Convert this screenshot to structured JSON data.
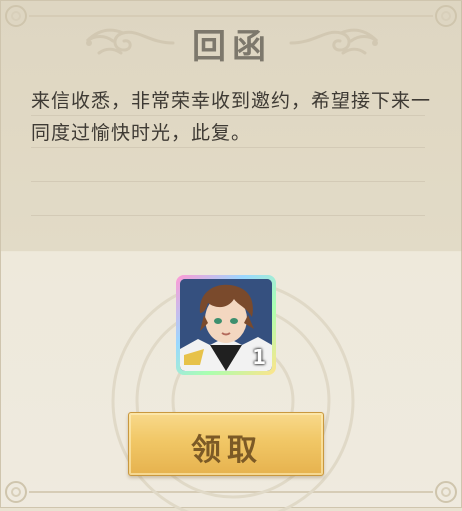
{
  "letter": {
    "title": "回函",
    "body": "来信收悉，非常荣幸收到邀约，希望接下来一同度过愉快时光，此复。"
  },
  "reward": {
    "icon": "character-portrait-icon",
    "count": "1"
  },
  "claim_button": {
    "label": "领取"
  },
  "colors": {
    "paper": "#e9e2d1",
    "title": "#7d786c",
    "button_gold": "#f1c766",
    "button_text": "#7c5a26"
  }
}
